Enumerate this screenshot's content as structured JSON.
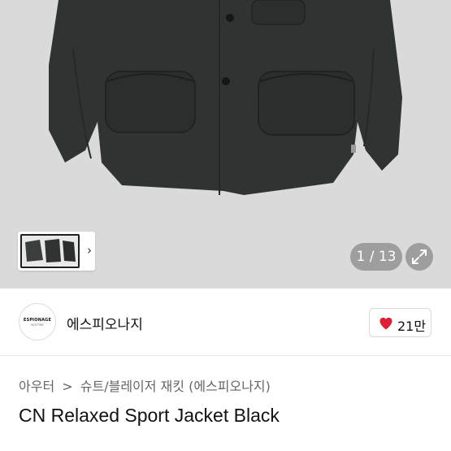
{
  "gallery": {
    "counter": "1 / 13",
    "thumb_next_icon": "chevron-right-icon",
    "expand_icon": "expand-icon"
  },
  "brand": {
    "logo_text": "ESPIONAGE",
    "logo_subtext": "N.37°56'",
    "name": "에스피오나지"
  },
  "like": {
    "icon": "heart-icon",
    "count": "21만",
    "color": "#e01e37"
  },
  "breadcrumb": {
    "level1": "아우터",
    "separator": ">",
    "level2": "슈트/블레이저 재킷 (에스피오나지)"
  },
  "product": {
    "title": "CN Relaxed Sport Jacket Black"
  }
}
